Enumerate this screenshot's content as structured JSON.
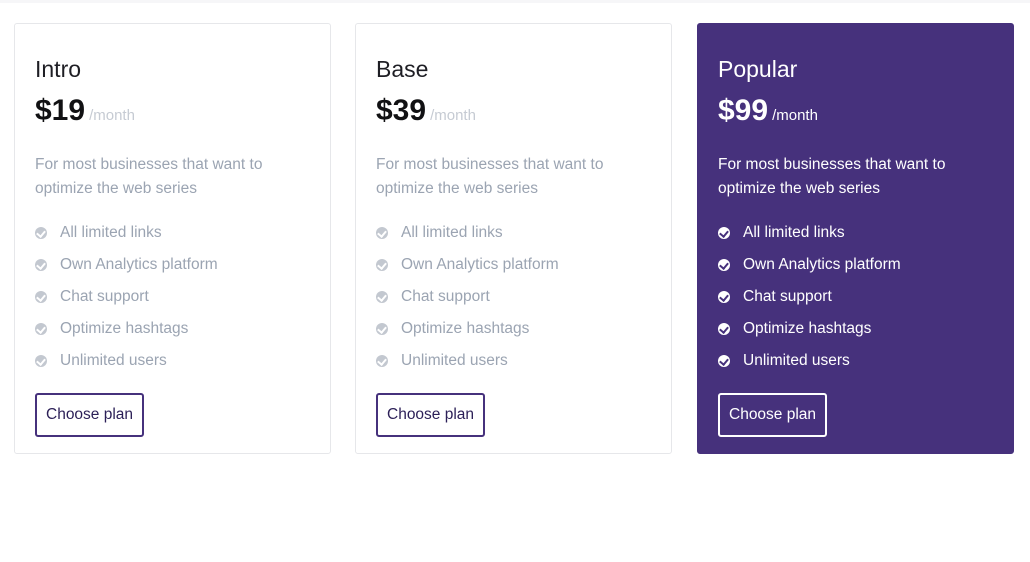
{
  "plans": [
    {
      "name": "Intro",
      "price": "$19",
      "period": "/month",
      "description": "For most businesses that want to optimize the web series",
      "features": [
        "All limited links",
        "Own Analytics platform",
        "Chat support",
        "Optimize hashtags",
        "Unlimited users"
      ],
      "button_label": "Choose plan",
      "highlighted": false
    },
    {
      "name": "Base",
      "price": "$39",
      "period": "/month",
      "description": "For most businesses that want to optimize the web series",
      "features": [
        "All limited links",
        "Own Analytics platform",
        "Chat support",
        "Optimize hashtags",
        "Unlimited users"
      ],
      "button_label": "Choose plan",
      "highlighted": false
    },
    {
      "name": "Popular",
      "price": "$99",
      "period": "/month",
      "description": "For most businesses that want to optimize the web series",
      "features": [
        "All limited links",
        "Own Analytics platform",
        "Chat support",
        "Optimize hashtags",
        "Unlimited users"
      ],
      "button_label": "Choose plan",
      "highlighted": true
    }
  ],
  "icons": {
    "feature": "check-circle-icon"
  },
  "colors": {
    "accent": "#46317c",
    "muted_text": "#9ba4b2",
    "card_border": "#e6e7ea"
  }
}
